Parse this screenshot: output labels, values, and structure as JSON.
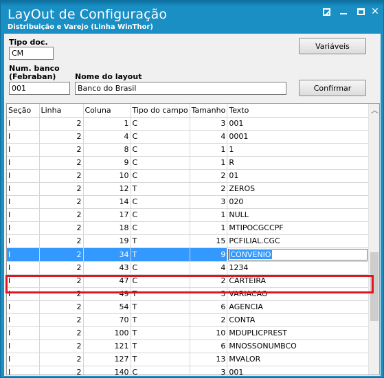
{
  "window": {
    "title": "LayOut de Configuração",
    "subtitle": "Distribuição e Varejo (Linha WinThor)"
  },
  "form": {
    "tipo_doc_label": "Tipo doc.",
    "tipo_doc_value": "CM",
    "num_banco_label_1": "Num. banco",
    "num_banco_label_2": "(Febraban)",
    "num_banco_value": "001",
    "nome_layout_label": "Nome do layout",
    "nome_layout_value": "Banco do Brasil",
    "variaveis_label": "Variáveis",
    "confirmar_label": "Confirmar"
  },
  "grid": {
    "columns": [
      "Seção",
      "Linha",
      "Coluna",
      "Tipo do campo",
      "Tamanho",
      "Texto"
    ],
    "rows": [
      [
        "I",
        "2",
        "1",
        "C",
        "3",
        "001"
      ],
      [
        "I",
        "2",
        "4",
        "C",
        "4",
        "0001"
      ],
      [
        "I",
        "2",
        "8",
        "C",
        "1",
        "1"
      ],
      [
        "I",
        "2",
        "9",
        "C",
        "1",
        "R"
      ],
      [
        "I",
        "2",
        "10",
        "C",
        "2",
        "01"
      ],
      [
        "I",
        "2",
        "12",
        "T",
        "2",
        "ZEROS"
      ],
      [
        "I",
        "2",
        "14",
        "C",
        "3",
        "020"
      ],
      [
        "I",
        "2",
        "17",
        "C",
        "1",
        "NULL"
      ],
      [
        "I",
        "2",
        "18",
        "C",
        "1",
        "MTIPOCGCCPF"
      ],
      [
        "I",
        "2",
        "19",
        "T",
        "15",
        "PCFILIAL.CGC"
      ],
      [
        "I",
        "2",
        "34",
        "T",
        "9",
        "CONVENIO"
      ],
      [
        "I",
        "2",
        "43",
        "C",
        "4",
        "1234"
      ],
      [
        "I",
        "2",
        "47",
        "C",
        "2",
        "CARTEIRA"
      ],
      [
        "I",
        "2",
        "49",
        "T",
        "3",
        "VARIACAO"
      ],
      [
        "I",
        "2",
        "54",
        "T",
        "6",
        "AGENCIA"
      ],
      [
        "I",
        "2",
        "70",
        "T",
        "2",
        "CONTA"
      ],
      [
        "I",
        "2",
        "100",
        "T",
        "10",
        "MDUPLICPREST"
      ],
      [
        "I",
        "2",
        "121",
        "T",
        "6",
        "MNOSSONUMBCO"
      ],
      [
        "I",
        "2",
        "127",
        "T",
        "13",
        "MVALOR"
      ],
      [
        "I",
        "2",
        "140",
        "C",
        "3",
        "001"
      ]
    ],
    "selected_row": 10
  },
  "colors": {
    "titlebar": "#1a8fc4",
    "selection": "#3399ff",
    "highlight_border": "#e0151f"
  }
}
